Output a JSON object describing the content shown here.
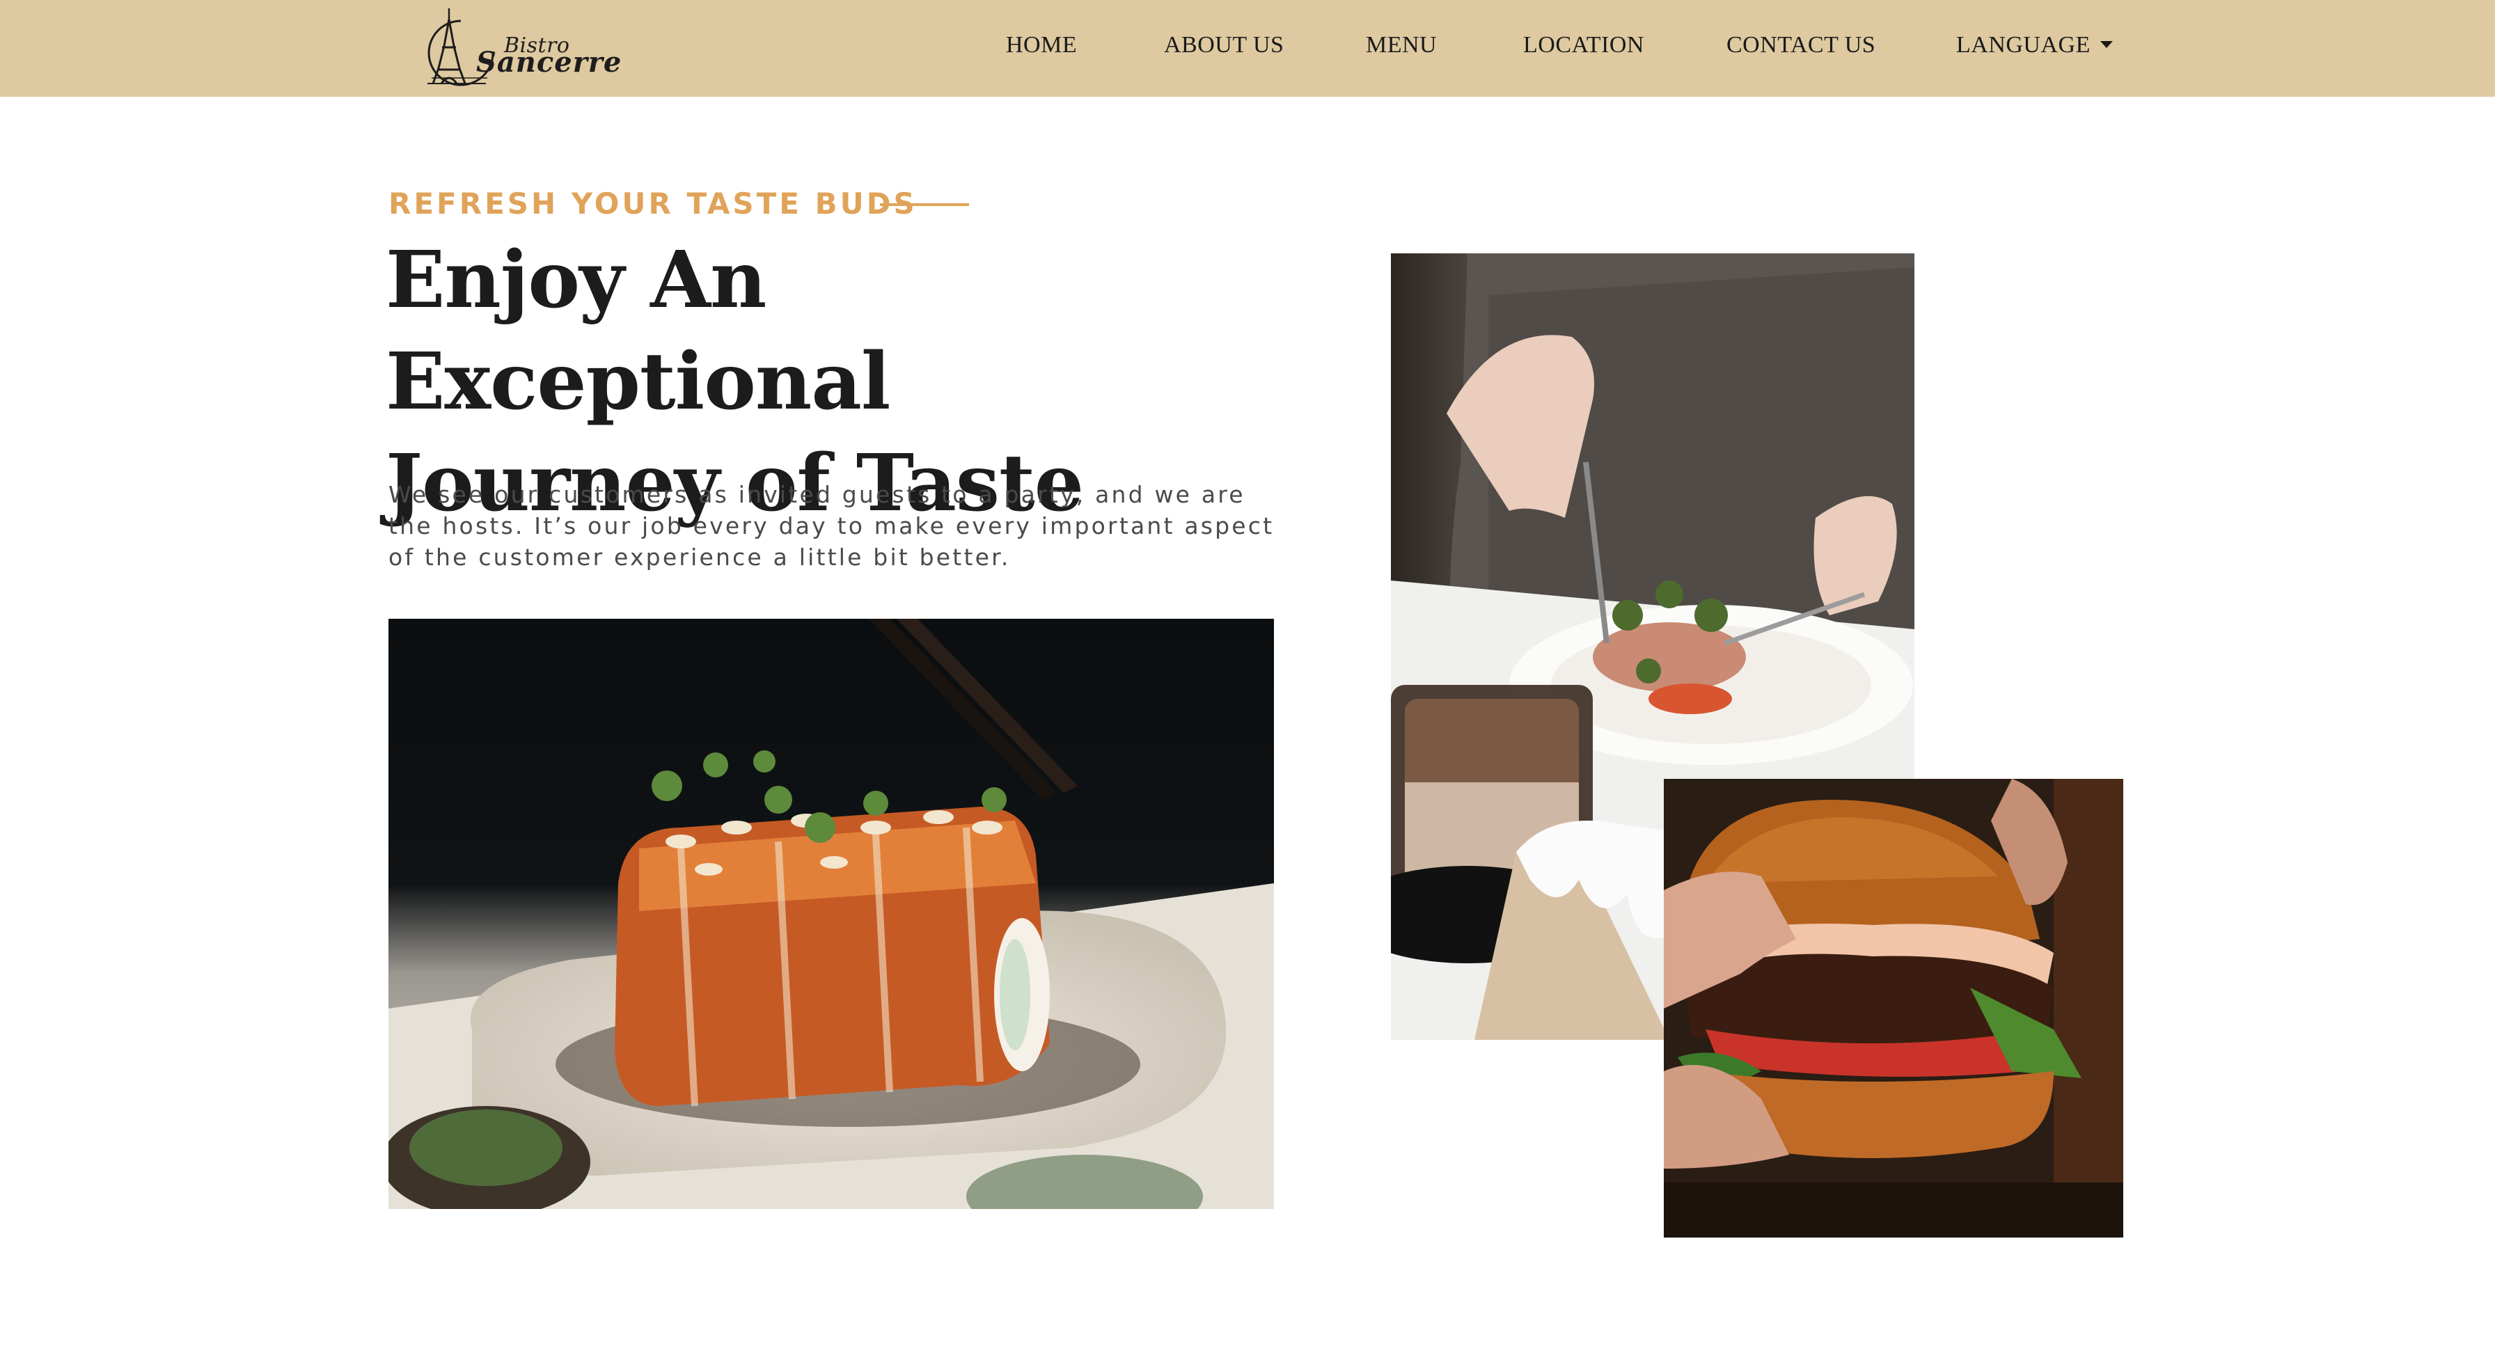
{
  "header": {
    "logo": {
      "brand_line1": "Bistro",
      "brand_line2": "Sancerre"
    },
    "nav": [
      {
        "label": "HOME"
      },
      {
        "label": "ABOUT US"
      },
      {
        "label": "MENU"
      },
      {
        "label": "LOCATION"
      },
      {
        "label": "CONTACT US"
      },
      {
        "label": "LANGUAGE"
      }
    ]
  },
  "hero": {
    "eyebrow": "REFRESH YOUR TASTE BUDS",
    "headline_line1": "Enjoy An Exceptional",
    "headline_line2": "Journey of Taste",
    "body": "We see our customers as invited guests to a party, and we are the hosts. It’s our job every day to make every important aspect of the customer experience a little bit better."
  },
  "colors": {
    "navbar_bg": "#dec9a0",
    "accent": "#e0a35a",
    "heading": "#1c1c1c",
    "body_text": "#4a4a4a"
  },
  "icons": {
    "logo": "eiffel-tower-logo-icon",
    "language_caret": "caret-down-icon"
  }
}
